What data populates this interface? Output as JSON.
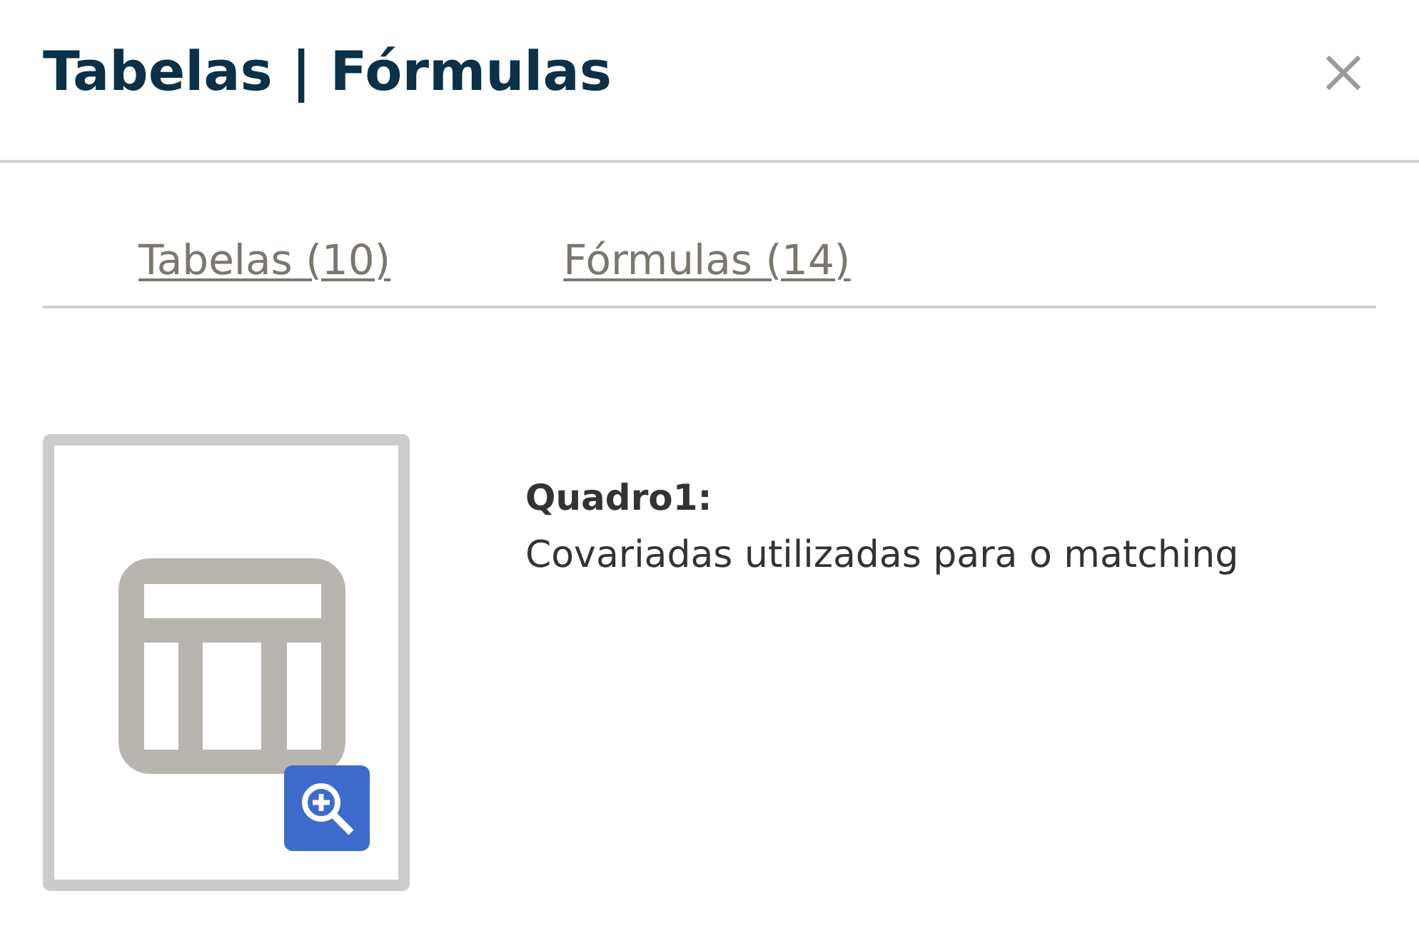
{
  "dialog": {
    "title": "Tabelas | Fórmulas"
  },
  "tabs": [
    {
      "label": "Tabelas (10)",
      "selected": false
    },
    {
      "label": "Fórmulas (14)",
      "selected": false
    }
  ],
  "items": [
    {
      "label": "Quadro1:",
      "caption": "Covariadas utilizadas para o matching"
    }
  ]
}
